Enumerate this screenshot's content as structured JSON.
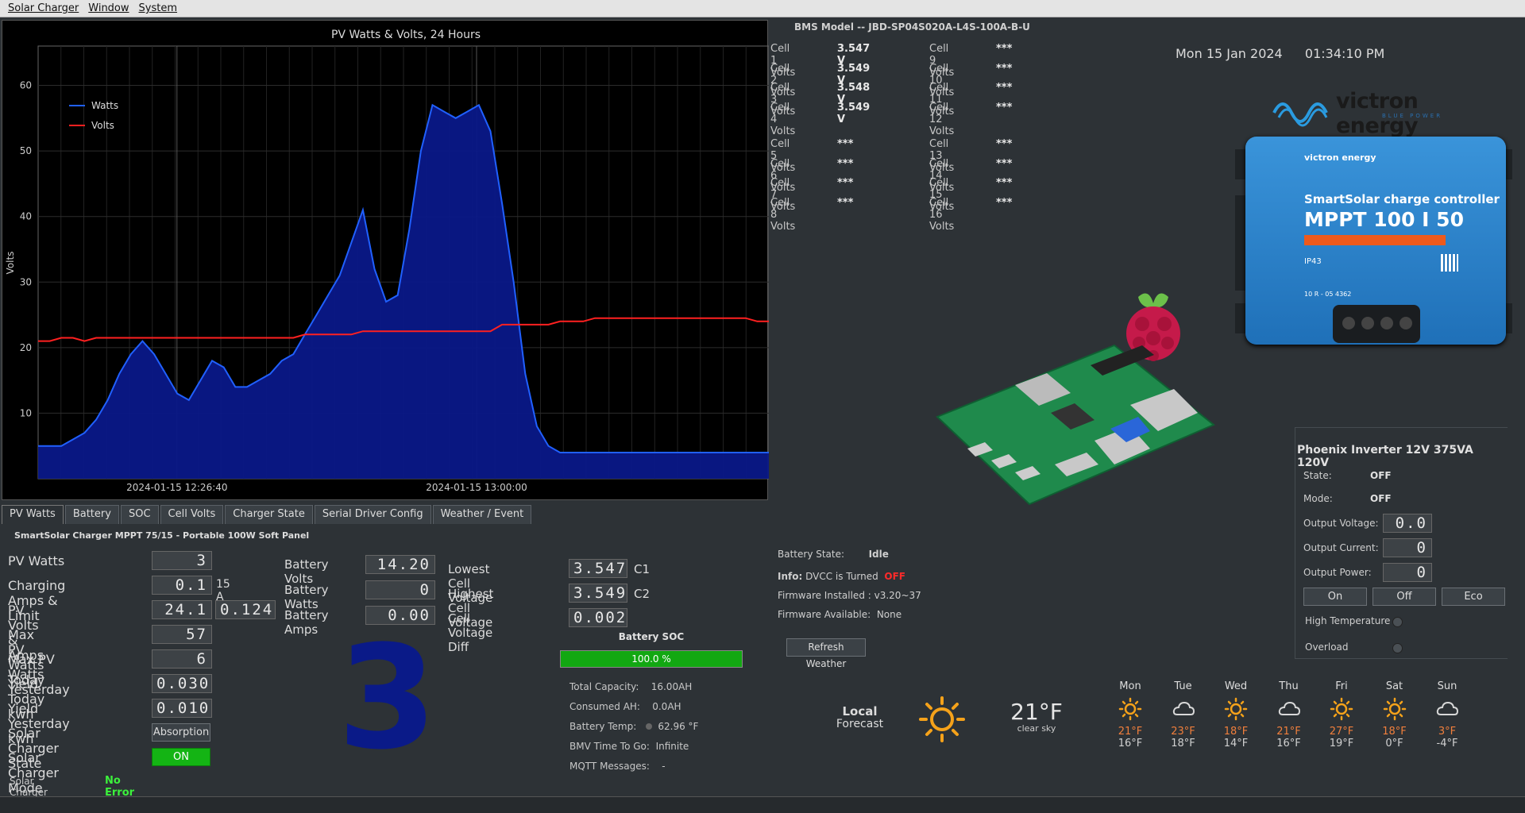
{
  "menubar": {
    "items": [
      "Solar Charger",
      "Window",
      "System"
    ]
  },
  "chart_data": {
    "type": "line",
    "title": "PV Watts & Volts, 24 Hours",
    "ylabel": "Volts",
    "xlabel": "",
    "x_ticks": [
      "2024-01-15 12:26:40",
      "2024-01-15 13:00:00"
    ],
    "y_ticks": [
      10,
      20,
      30,
      40,
      50,
      60
    ],
    "ylim": [
      0,
      66
    ],
    "legend_position": "top-left",
    "series": [
      {
        "name": "Watts",
        "color": "#2060ff",
        "values": [
          5,
          5,
          5,
          6,
          7,
          9,
          12,
          16,
          19,
          21,
          19,
          16,
          13,
          12,
          15,
          18,
          17,
          14,
          14,
          15,
          16,
          18,
          19,
          22,
          25,
          28,
          31,
          36,
          41,
          32,
          27,
          28,
          38,
          50,
          57,
          56,
          55,
          56,
          57,
          53,
          42,
          30,
          16,
          8,
          5,
          4,
          4,
          4,
          4,
          4,
          4,
          4,
          4,
          4,
          4,
          4,
          4,
          4,
          4,
          4,
          4,
          4,
          4,
          4
        ]
      },
      {
        "name": "Volts",
        "color": "#ff2020",
        "values": [
          21,
          21,
          21.5,
          21.5,
          21,
          21.5,
          21.5,
          21.5,
          21.5,
          21.5,
          21.5,
          21.5,
          21.5,
          21.5,
          21.5,
          21.5,
          21.5,
          21.5,
          21.5,
          21.5,
          21.5,
          21.5,
          21.5,
          22,
          22,
          22,
          22,
          22,
          22.5,
          22.5,
          22.5,
          22.5,
          22.5,
          22.5,
          22.5,
          22.5,
          22.5,
          22.5,
          22.5,
          22.5,
          23.5,
          23.5,
          23.5,
          23.5,
          23.5,
          24,
          24,
          24,
          24.5,
          24.5,
          24.5,
          24.5,
          24.5,
          24.5,
          24.5,
          24.5,
          24.5,
          24.5,
          24.5,
          24.5,
          24.5,
          24.5,
          24,
          24
        ]
      }
    ]
  },
  "tabs": [
    "PV Watts",
    "Battery",
    "SOC",
    "Cell Volts",
    "Charger State",
    "Serial Driver Config",
    "Weather / Event"
  ],
  "panel": {
    "title": "SmartSolar Charger MPPT 75/15 - Portable 100W Soft Panel",
    "rows": [
      {
        "label": "PV Watts",
        "value": "3"
      },
      {
        "label": "Charging Amps & Limit",
        "value": "0.1",
        "extra": "15 A"
      },
      {
        "label": "PV Volts & Amps",
        "value": "24.1",
        "value2": "0.124"
      },
      {
        "label": "Max PV Watts Today",
        "value": "57"
      },
      {
        "label": "Max PV Watts Yesterday",
        "value": "6"
      },
      {
        "label": "Yield Today kwh",
        "value": "0.030"
      },
      {
        "label": "Yield Yesterday kwh",
        "value": "0.010"
      },
      {
        "label": "Solar Charger State",
        "value": "Absorption"
      },
      {
        "label": "Solar Charger Mode",
        "value": "ON"
      }
    ],
    "error_label": "Solar Charger Error:",
    "error_value": "No Error",
    "big_number": "3"
  },
  "battery": {
    "rows": [
      {
        "label": "Battery Volts",
        "value": "14.20"
      },
      {
        "label": "Battery Watts",
        "value": "0"
      },
      {
        "label": "Battery Amps",
        "value": "0.00"
      }
    ],
    "cells": [
      {
        "label": "Lowest Cell Voltage",
        "value": "3.547",
        "tag": "C1"
      },
      {
        "label": "Highest Cell Voltage",
        "value": "3.549",
        "tag": "C2"
      },
      {
        "label": "Cell Voltage Diff",
        "value": "0.002",
        "tag": ""
      }
    ],
    "soc_title": "Battery SOC",
    "soc_text": "100.0 %",
    "soc_fraction": 1.0,
    "info": [
      {
        "label": "Total Capacity:",
        "value": "16.00AH"
      },
      {
        "label": "Consumed AH:",
        "value": "0.0AH"
      },
      {
        "label": "Battery Temp:",
        "value": "62.96 °F"
      },
      {
        "label": "BMV Time To Go:",
        "value": "Infinite"
      },
      {
        "label": "MQTT Messages:",
        "value": "-"
      }
    ]
  },
  "bms": {
    "model": "BMS Model -- JBD-SP04S020A-L4S-100A-B-U",
    "cells_left": [
      {
        "label": "Cell 1 Volts",
        "value": "3.547 V"
      },
      {
        "label": "Cell 2 Volts",
        "value": "3.549 V"
      },
      {
        "label": "Cell 3 Volts",
        "value": "3.548 V"
      },
      {
        "label": "Cell 4 Volts",
        "value": "3.549 V"
      },
      {
        "label": "Cell 5 Volts",
        "value": "***"
      },
      {
        "label": "Cell 6 Volts",
        "value": "***"
      },
      {
        "label": "Cell 7 Volts",
        "value": "***"
      },
      {
        "label": "Cell 8 Volts",
        "value": "***"
      }
    ],
    "cells_right": [
      {
        "label": "Cell 9 Volts",
        "value": "***"
      },
      {
        "label": "Cell 10 Volts",
        "value": "***"
      },
      {
        "label": "Cell 11 Volts",
        "value": "***"
      },
      {
        "label": "Cell 12 Volts",
        "value": "***"
      },
      {
        "label": "Cell 13 Volts",
        "value": "***"
      },
      {
        "label": "Cell 14 Volts",
        "value": "***"
      },
      {
        "label": "Cell 15 Volts",
        "value": "***"
      },
      {
        "label": "Cell 16 Volts",
        "value": "***"
      }
    ]
  },
  "clock": {
    "date": "Mon 15 Jan 2024",
    "time": "01:34:10 PM"
  },
  "victron": {
    "brand": "victron energy",
    "tagline": "BLUE POWER",
    "product_line1": "SmartSolar charge controller",
    "product_line2": "MPPT 100 I 50",
    "ip": "IP43",
    "code": "10 R - 05 4362"
  },
  "status": {
    "battery_state_label": "Battery State:",
    "battery_state": "Idle",
    "info_label": "Info:",
    "info_text": "DVCC is Turned",
    "info_state": "OFF",
    "fw_installed_label": "Firmware Installed :",
    "fw_installed": "v3.20~37",
    "fw_available_label": "Firmware Available:",
    "fw_available": "None",
    "refresh_button": "Refresh Weather"
  },
  "inverter": {
    "title": "Phoenix Inverter 12V 375VA 120V",
    "state_label": "State:",
    "state": "OFF",
    "mode_label": "Mode:",
    "mode": "OFF",
    "rows": [
      {
        "label": "Output Voltage:",
        "value": "0.0"
      },
      {
        "label": "Output Current:",
        "value": "0"
      },
      {
        "label": "Output Power:",
        "value": "0"
      }
    ],
    "buttons": [
      "On",
      "Off",
      "Eco"
    ],
    "alarms": [
      "High Temperature",
      "Overload"
    ]
  },
  "weather": {
    "local_label": "Local",
    "forecast_label": "Forecast",
    "current_temp": "21°F",
    "current_desc": "clear sky",
    "days": [
      {
        "day": "Mon",
        "icon": "sun",
        "hi": "21°F",
        "lo": "16°F"
      },
      {
        "day": "Tue",
        "icon": "cloud",
        "hi": "23°F",
        "lo": "18°F"
      },
      {
        "day": "Wed",
        "icon": "sun",
        "hi": "18°F",
        "lo": "14°F"
      },
      {
        "day": "Thu",
        "icon": "cloud",
        "hi": "21°F",
        "lo": "16°F"
      },
      {
        "day": "Fri",
        "icon": "sun",
        "hi": "27°F",
        "lo": "19°F"
      },
      {
        "day": "Sat",
        "icon": "sun",
        "hi": "18°F",
        "lo": "0°F"
      },
      {
        "day": "Sun",
        "icon": "cloud",
        "hi": "3°F",
        "lo": "-4°F"
      }
    ]
  }
}
